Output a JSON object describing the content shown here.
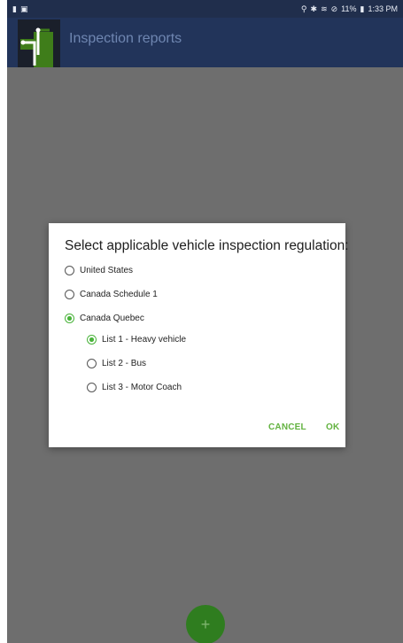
{
  "status_bar": {
    "battery_percent": "11%",
    "time": "1:33 PM",
    "icons": [
      "sim-card-icon",
      "image-icon",
      "location-icon",
      "bluetooth-icon",
      "wifi-icon",
      "do-not-disturb-icon",
      "battery-icon"
    ]
  },
  "app_bar": {
    "title": "Inspection reports",
    "logo_colors": {
      "green": "#3f7d1a",
      "dark": "#1a1f2a",
      "white": "#ffffff"
    }
  },
  "dialog": {
    "title": "Select applicable vehicle inspection regulation:",
    "options": [
      {
        "label": "United States",
        "selected": false
      },
      {
        "label": "Canada Schedule 1",
        "selected": false
      },
      {
        "label": "Canada Quebec",
        "selected": true
      }
    ],
    "sub_options": [
      {
        "label": "List 1 - Heavy vehicle",
        "selected": true
      },
      {
        "label": "List 2 - Bus",
        "selected": false
      },
      {
        "label": "List 3 - Motor Coach",
        "selected": false
      }
    ],
    "cancel_label": "CANCEL",
    "ok_label": "OK"
  },
  "fab": {
    "label": "+",
    "icon": "add-icon"
  },
  "colors": {
    "app_bar": "#22345a",
    "accent_green": "#49b33a",
    "action_text": "#62b23f",
    "scrim": "#6e6e6e"
  }
}
